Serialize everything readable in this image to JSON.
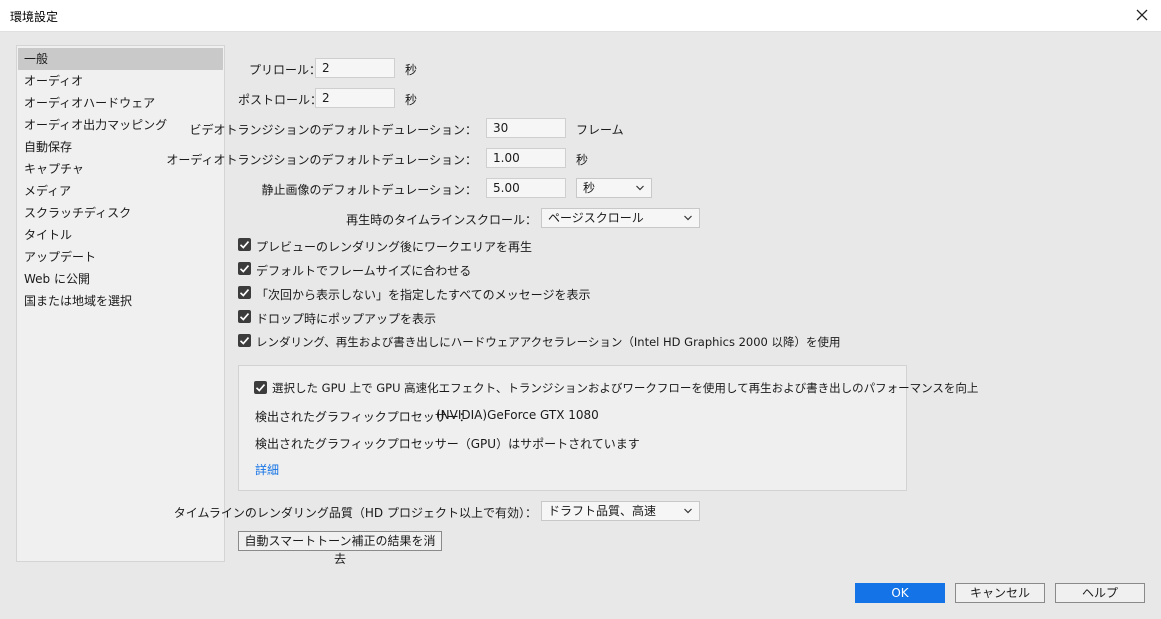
{
  "window": {
    "title": "環境設定"
  },
  "sidebar": {
    "items": [
      {
        "label": "一般"
      },
      {
        "label": "オーディオ"
      },
      {
        "label": "オーディオハードウェア"
      },
      {
        "label": "オーディオ出力マッピング"
      },
      {
        "label": "自動保存"
      },
      {
        "label": "キャプチャ"
      },
      {
        "label": "メディア"
      },
      {
        "label": "スクラッチディスク"
      },
      {
        "label": "タイトル"
      },
      {
        "label": "アップデート"
      },
      {
        "label": "Web に公開"
      },
      {
        "label": "国または地域を選択"
      }
    ],
    "active_index": 0
  },
  "general": {
    "preroll": {
      "label": "プリロール：",
      "value": "2",
      "unit": "秒"
    },
    "postroll": {
      "label": "ポストロール：",
      "value": "2",
      "unit": "秒"
    },
    "video_transition": {
      "label": "ビデオトランジションのデフォルトデュレーション：",
      "value": "30",
      "unit": "フレーム"
    },
    "audio_transition": {
      "label": "オーディオトランジションのデフォルトデュレーション：",
      "value": "1.00",
      "unit": "秒"
    },
    "still_image": {
      "label": "静止画像のデフォルトデュレーション：",
      "value": "5.00",
      "unit_selected": "秒"
    },
    "timeline_scroll": {
      "label": "再生時のタイムラインスクロール：",
      "selected": "ページスクロール"
    },
    "checkboxes": [
      {
        "label": "プレビューのレンダリング後にワークエリアを再生",
        "checked": true
      },
      {
        "label": "デフォルトでフレームサイズに合わせる",
        "checked": true
      },
      {
        "label": "「次回から表示しない」を指定したすべてのメッセージを表示",
        "checked": true
      },
      {
        "label": "ドロップ時にポップアップを表示",
        "checked": true
      },
      {
        "label": "レンダリング、再生および書き出しにハードウェアアクセラレーション（Intel HD Graphics 2000 以降）を使用",
        "checked": true
      }
    ],
    "gpu": {
      "checkbox_label": "選択した GPU 上で GPU 高速化エフェクト、トランジションおよびワークフローを使用して再生および書き出しのパフォーマンスを向上",
      "checked": true,
      "detected_label": "検出されたグラフィックプロセッサー：",
      "detected_value": "(NVIDIA)GeForce GTX 1080",
      "supported_text": "検出されたグラフィックプロセッサー（GPU）はサポートされています",
      "details_link": "詳細"
    },
    "render_quality": {
      "label": "タイムラインのレンダリング品質（HD プロジェクト以上で有効）：",
      "selected": "ドラフト品質、高速"
    },
    "clear_button": "自動スマートトーン補正の結果を消去"
  },
  "footer": {
    "ok": "OK",
    "cancel": "キャンセル",
    "help": "ヘルプ"
  },
  "colors": {
    "accent": "#1473e6",
    "checkbox": "#3c3c3c",
    "background": "#e8e8e8"
  }
}
